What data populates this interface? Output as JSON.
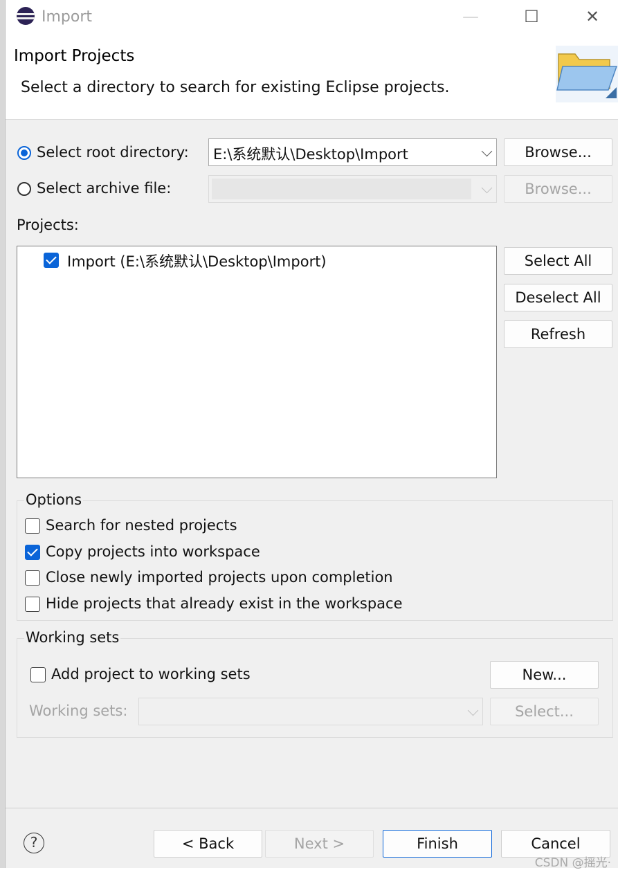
{
  "window": {
    "title": "Import",
    "minimize_glyph": "—",
    "maximize_glyph": "☐",
    "close_glyph": "✕"
  },
  "header": {
    "title": "Import Projects",
    "subtitle": "Select a directory to search for existing Eclipse projects.",
    "icon": "folder-icon"
  },
  "source": {
    "root_label": "Select root directory:",
    "root_value": "E:\\系统默认\\Desktop\\Import",
    "root_selected": true,
    "archive_label": "Select archive file:",
    "archive_value": "",
    "browse_label": "Browse...",
    "browse_disabled_label": "Browse..."
  },
  "projects": {
    "label": "Projects:",
    "items": [
      {
        "label": "Import (E:\\系统默认\\Desktop\\Import)",
        "checked": true
      }
    ],
    "select_all": "Select All",
    "deselect_all": "Deselect All",
    "refresh": "Refresh"
  },
  "options": {
    "title": "Options",
    "items": [
      {
        "label": "Search for nested projects",
        "checked": false
      },
      {
        "label": "Copy projects into workspace",
        "checked": true
      },
      {
        "label": "Close newly imported projects upon completion",
        "checked": false
      },
      {
        "label": "Hide projects that already exist in the workspace",
        "checked": false
      }
    ]
  },
  "working_sets": {
    "title": "Working sets",
    "add_label": "Add project to working sets",
    "new_button": "New...",
    "sets_label": "Working sets:",
    "sets_value": "",
    "select_button": "Select..."
  },
  "footer": {
    "help_glyph": "?",
    "back": "< Back",
    "next": "Next >",
    "finish": "Finish",
    "cancel": "Cancel"
  },
  "watermark": "CSDN @摇光·",
  "colors": {
    "accent": "#0a64d8",
    "window_bg": "#f0f0f0"
  }
}
